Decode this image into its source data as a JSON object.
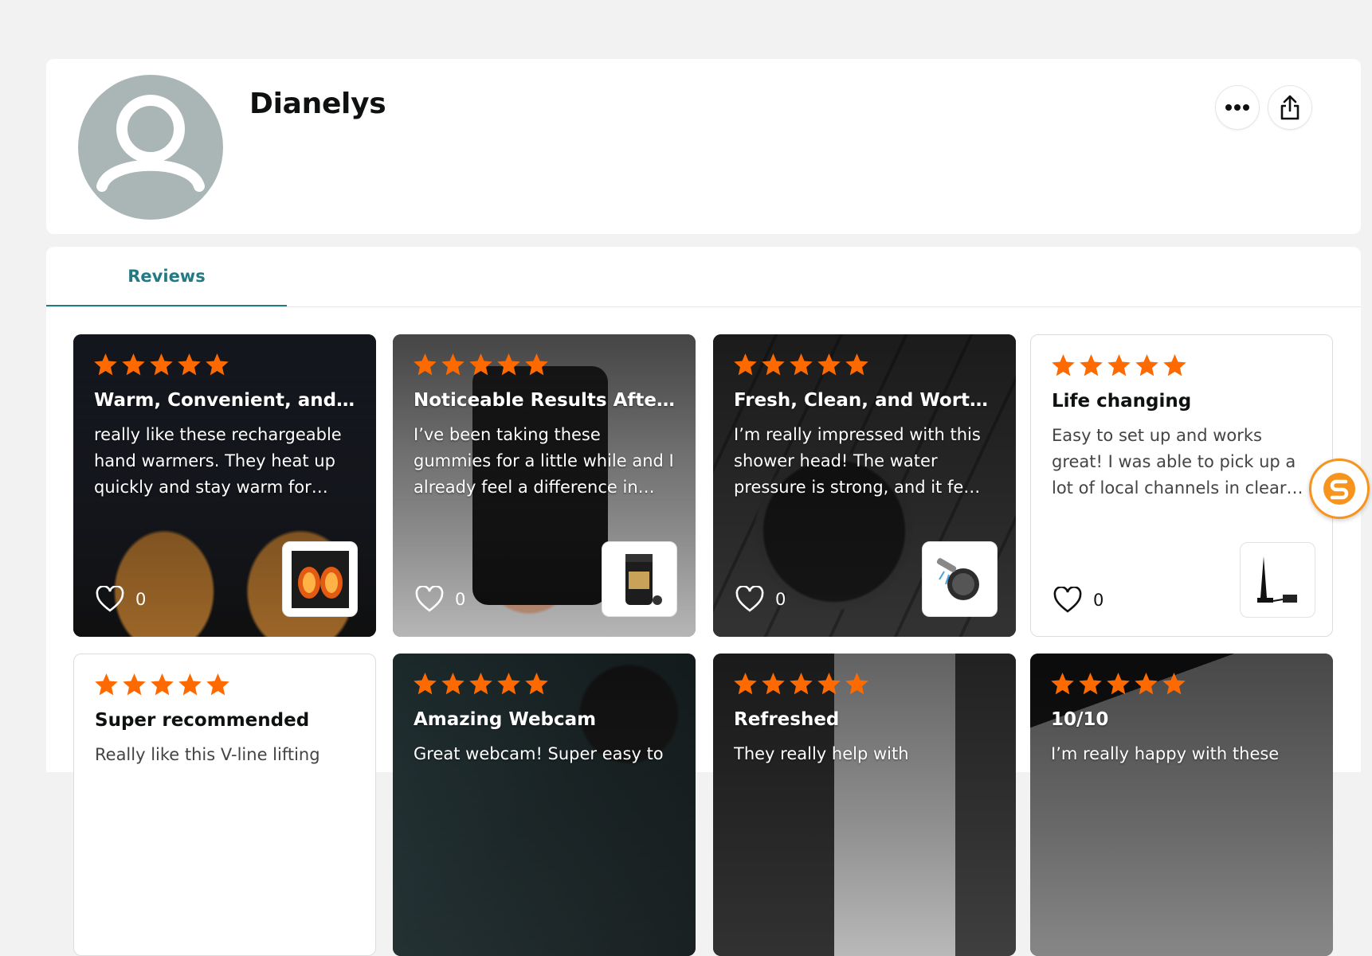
{
  "profile": {
    "name": "Dianelys",
    "avatar_icon": "default-user-icon",
    "more_icon": "ellipsis-icon",
    "share_icon": "share-icon"
  },
  "tabs": [
    {
      "label": "Reviews",
      "active": true
    }
  ],
  "colors": {
    "accent": "#227a83",
    "star": "#ff6a00",
    "avatar_bg": "#aab6b6",
    "badge": "#f7941d"
  },
  "reviews": [
    {
      "rating": 5,
      "title": "Warm, Convenient, and ...",
      "body": "really like these rechargeable hand warmers. They heat up quickly and stay warm for…",
      "likes": "0",
      "style": "dark",
      "product": "hand-warmers"
    },
    {
      "rating": 5,
      "title": "Noticeable Results After ...",
      "body": "I’ve been taking these gummies for a little while and I already feel a difference in…",
      "likes": "0",
      "style": "dark",
      "product": "shilajit-gummies"
    },
    {
      "rating": 5,
      "title": "Fresh, Clean, and Worth It!",
      "body": "I’m really impressed with this shower head! The water pressure is strong, and it fe…",
      "likes": "0",
      "style": "dark",
      "product": "shower-head"
    },
    {
      "rating": 5,
      "title": "Life changing",
      "body": "Easy to set up and works great! I was able to pick up a lot of local channels in clear…",
      "likes": "0",
      "style": "light",
      "product": "tv-antenna"
    },
    {
      "rating": 5,
      "title": "Super recommended",
      "body": "Really like this V-line lifting",
      "likes": "",
      "style": "light",
      "product": ""
    },
    {
      "rating": 5,
      "title": "Amazing Webcam",
      "body": "Great webcam! Super easy to",
      "likes": "",
      "style": "dark",
      "product": "webcam"
    },
    {
      "rating": 5,
      "title": "Refreshed",
      "body": "They really help with",
      "likes": "",
      "style": "dark",
      "product": "vaginal-product"
    },
    {
      "rating": 5,
      "title": "10/10",
      "body": "I’m really happy with these",
      "likes": "",
      "style": "dark",
      "product": "earbuds"
    }
  ],
  "floating_badge": {
    "icon": "s-logo-icon"
  }
}
